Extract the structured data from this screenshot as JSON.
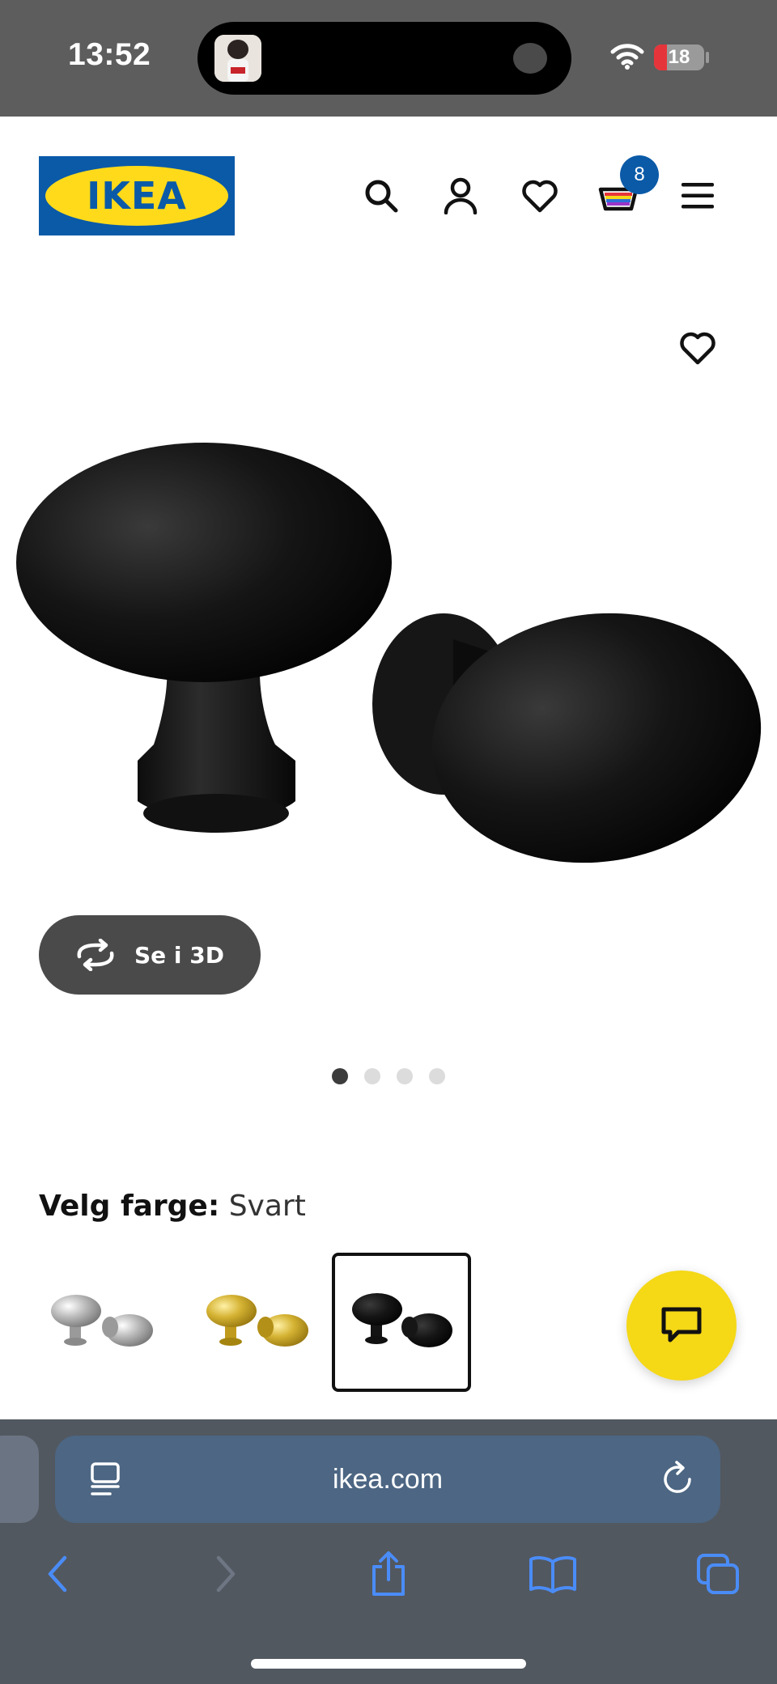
{
  "status_bar": {
    "time": "13:52",
    "battery_level": "18"
  },
  "header": {
    "logo_text": "IKEA",
    "cart_count": "8",
    "icons": [
      "search-icon",
      "account-icon",
      "heart-icon",
      "cart-icon",
      "menu-icon"
    ],
    "brand_colors": {
      "blue": "#0a5aa8",
      "yellow": "#ffda1a"
    }
  },
  "product": {
    "view_3d_label": "Se i 3D",
    "image_count": 4,
    "active_image_index": 0,
    "color_label": "Velg farge:",
    "color_value": "Svart",
    "swatches": [
      {
        "name": "chrome",
        "selected": false
      },
      {
        "name": "gold",
        "selected": false
      },
      {
        "name": "black",
        "selected": true
      }
    ]
  },
  "browser": {
    "url": "ikea.com",
    "accent": "#4a8cf7"
  }
}
